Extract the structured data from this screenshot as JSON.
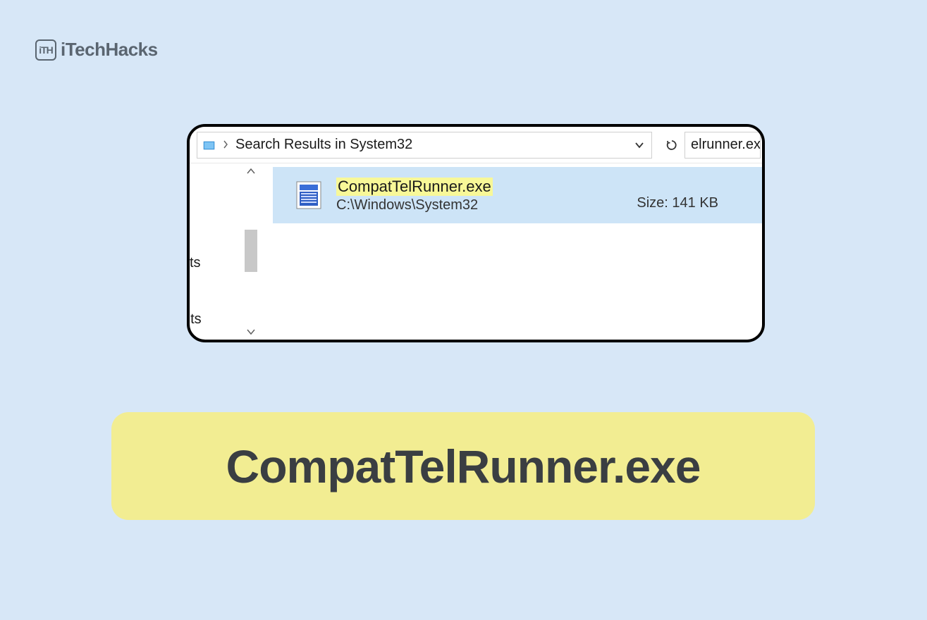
{
  "logo": {
    "icon_text": "iTH",
    "text": "iTechHacks"
  },
  "window": {
    "breadcrumb": "Search Results in System32",
    "search_value": "elrunner.ex",
    "left_pane": {
      "fragment_1": "cts",
      "fragment_2": "nts"
    },
    "result": {
      "filename": "CompatTelRunner.exe",
      "path": "C:\\Windows\\System32",
      "size_label": "Size:",
      "size_value": "141 KB"
    }
  },
  "caption": "CompatTelRunner.exe"
}
